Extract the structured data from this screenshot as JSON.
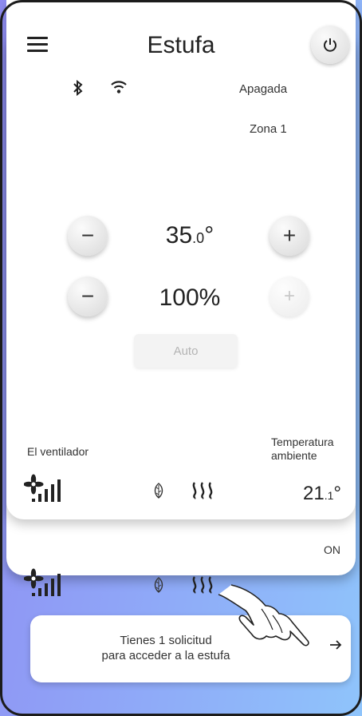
{
  "header": {
    "title": "Estufa",
    "menu_icon": "hamburger-menu-icon",
    "power_icon": "power-icon"
  },
  "status": {
    "bluetooth_icon": "bluetooth-icon",
    "wifi_icon": "wifi-icon",
    "state": "Apagada",
    "zone": "Zona 1"
  },
  "temperature_control": {
    "value_main": "35",
    "value_decimal": ".0",
    "unit": "°",
    "minus_label": "−",
    "plus_label": "+"
  },
  "power_control": {
    "value": "100%",
    "minus_label": "−",
    "plus_label": "+",
    "plus_disabled": true
  },
  "auto_button": {
    "label": "Auto",
    "disabled": true
  },
  "footer": {
    "fan_label": "El ventilador",
    "ambient_label_line1": "Temperatura",
    "ambient_label_line2": "ambiente",
    "ambient_main": "21",
    "ambient_decimal": ".1",
    "ambient_unit": "°",
    "second_row_state": "ON"
  },
  "request_banner": {
    "line1": "Tienes 1 solicitud",
    "line2": "para acceder a la estufa",
    "arrow_icon": "arrow-right-icon"
  },
  "colors": {
    "background_gradient": [
      "#8f8cf2",
      "#8fc4fb"
    ],
    "card": "#ffffff",
    "text": "#222222",
    "disabled": "#c8c8c8"
  }
}
